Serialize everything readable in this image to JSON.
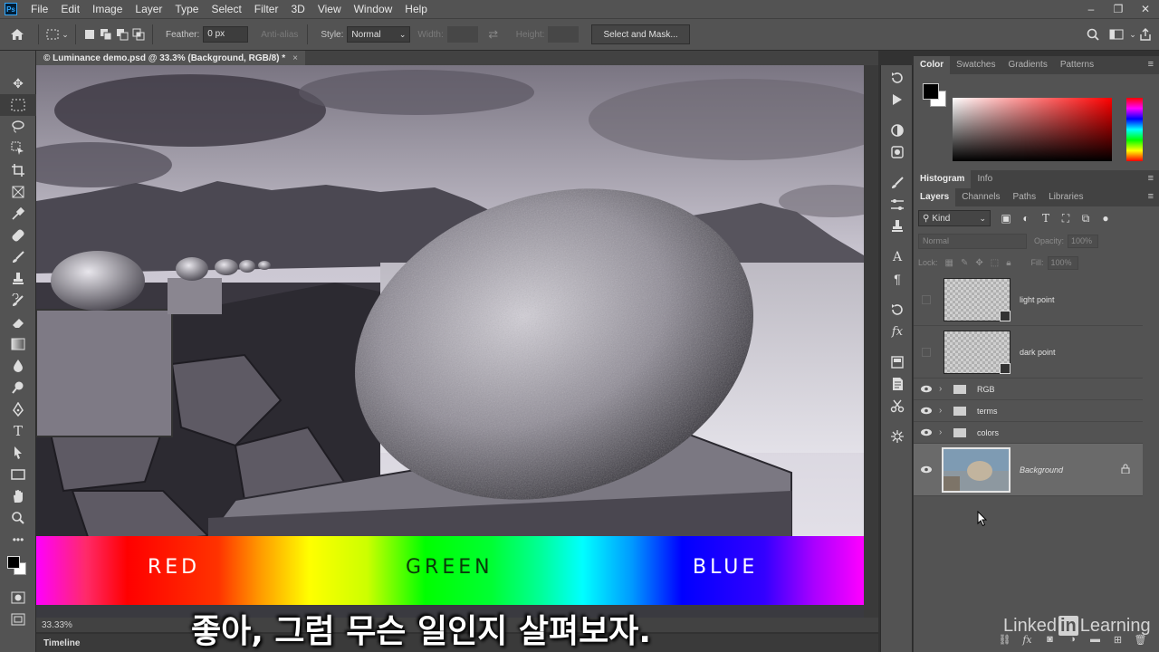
{
  "menubar": {
    "logo": "Ps",
    "items": [
      "File",
      "Edit",
      "Image",
      "Layer",
      "Type",
      "Select",
      "Filter",
      "3D",
      "View",
      "Window",
      "Help"
    ],
    "window_controls": [
      "–",
      "❐",
      "✕"
    ]
  },
  "options": {
    "feather_label": "Feather:",
    "feather_value": "0 px",
    "antialias_label": "Anti-alias",
    "style_label": "Style:",
    "style_value": "Normal",
    "width_label": "Width:",
    "height_label": "Height:",
    "select_mask": "Select and Mask..."
  },
  "document": {
    "tab_title": "© Luminance demo.psd @ 33.3% (Background, RGB/8) *",
    "close": "×",
    "zoom": "33.33%"
  },
  "timeline": {
    "label": "Timeline"
  },
  "spectrum": {
    "red": "RED",
    "green": "GREEN",
    "blue": "BLUE"
  },
  "caption": "좋아, 그럼 무슨 일인지 살펴보자.",
  "color_panel": {
    "tabs": [
      "Color",
      "Swatches",
      "Gradients",
      "Patterns"
    ],
    "foreground": "#000000",
    "background": "#ffffff"
  },
  "histogram_panel": {
    "tabs": [
      "Histogram",
      "Info"
    ]
  },
  "layers_panel": {
    "tabs": [
      "Layers",
      "Channels",
      "Paths",
      "Libraries"
    ],
    "kind": "Kind",
    "blend_mode": "Normal",
    "opacity_label": "Opacity:",
    "opacity_value": "100%",
    "lock_label": "Lock:",
    "fill_label": "Fill:",
    "fill_value": "100%",
    "layers": [
      {
        "name": "light point",
        "type": "layer",
        "visible": false
      },
      {
        "name": "dark point",
        "type": "layer",
        "visible": false
      },
      {
        "name": "RGB",
        "type": "group",
        "visible": true
      },
      {
        "name": "terms",
        "type": "group",
        "visible": true
      },
      {
        "name": "colors",
        "type": "group",
        "visible": true
      },
      {
        "name": "Background",
        "type": "background",
        "visible": true,
        "locked": true
      }
    ]
  },
  "watermark": {
    "linked": "Linked",
    "in": "in",
    "learning": "Learning"
  }
}
